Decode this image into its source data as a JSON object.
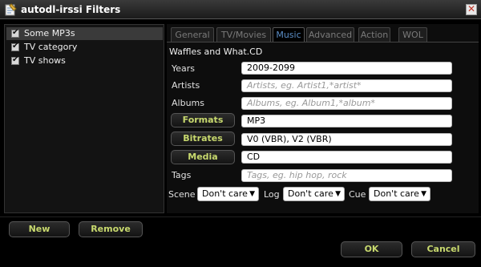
{
  "window": {
    "title": "autodl-irssi Filters",
    "app_icon": "notepad-icon",
    "close_icon": "close-icon",
    "close_glyph": "✕"
  },
  "filters": [
    {
      "label": "Some MP3s",
      "checked": true,
      "selected": true
    },
    {
      "label": "TV category",
      "checked": true,
      "selected": false
    },
    {
      "label": "TV shows",
      "checked": true,
      "selected": false
    }
  ],
  "check_glyph": "✔",
  "list_buttons": {
    "new": "New",
    "remove": "Remove"
  },
  "tabs": [
    {
      "label": "General",
      "active": false
    },
    {
      "label": "TV/Movies",
      "active": false
    },
    {
      "label": "Music",
      "active": true
    },
    {
      "label": "Advanced",
      "active": false
    },
    {
      "label": "Action",
      "active": false
    },
    {
      "label": "WOL",
      "active": false
    }
  ],
  "music": {
    "site": "Waffles and What.CD",
    "years": {
      "label": "Years",
      "value": "2009-2099"
    },
    "artists": {
      "label": "Artists",
      "placeholder": "Artists, eg. Artist1,*artist*"
    },
    "albums": {
      "label": "Albums",
      "placeholder": "Albums, eg. Album1,*album*"
    },
    "formats": {
      "button": "Formats",
      "value": "MP3"
    },
    "bitrates": {
      "button": "Bitrates",
      "value": "V0 (VBR), V2 (VBR)"
    },
    "media": {
      "button": "Media",
      "value": "CD"
    },
    "tags": {
      "label": "Tags",
      "placeholder": "Tags, eg. hip hop, rock"
    },
    "scene": {
      "label": "Scene",
      "value": "Don't care"
    },
    "log": {
      "label": "Log",
      "value": "Don't care"
    },
    "cue": {
      "label": "Cue",
      "value": "Don't care"
    }
  },
  "dialog_buttons": {
    "ok": "OK",
    "cancel": "Cancel"
  },
  "colors": {
    "accent_button_text": "#c8d96e",
    "active_tab_text": "#5b8ec7"
  }
}
